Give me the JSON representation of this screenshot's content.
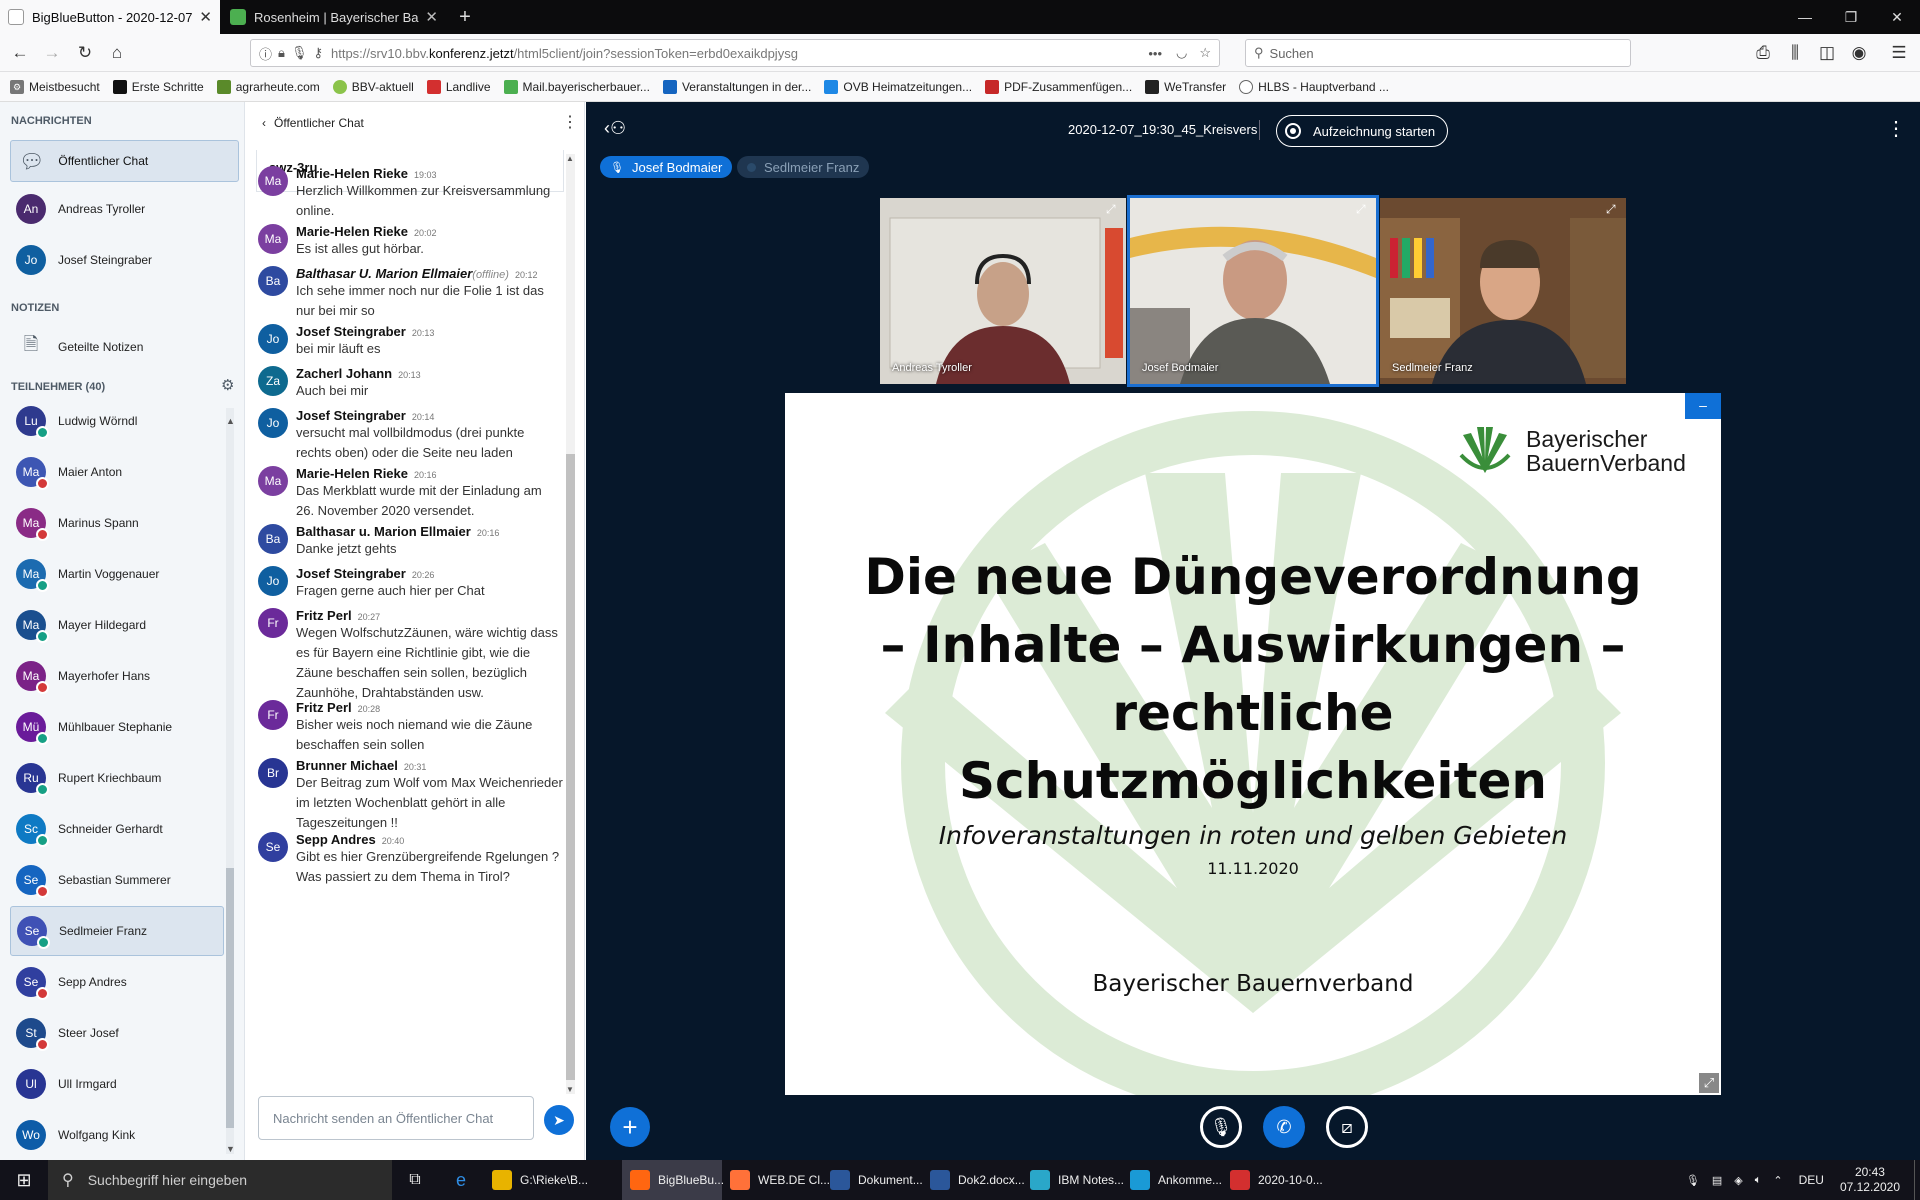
{
  "browser": {
    "tabs": [
      {
        "title": "BigBlueButton - 2020-12-07",
        "active": true
      },
      {
        "title": "Rosenheim | Bayerischer Bauern",
        "active": false
      }
    ],
    "new_tab": "+",
    "url_prefix": "https://srv10.bbv.",
    "url_domain": "konferenz.jetzt",
    "url_path": "/html5client/join?sessionToken=erbd0exaikdpjysg",
    "url_dots": "•••",
    "search_placeholder": "Suchen",
    "bookmarks": [
      "Meistbesucht",
      "Erste Schritte",
      "agrarheute.com",
      "BBV-aktuell",
      "Landlive",
      "Mail.bayerischerbauer...",
      "Veranstaltungen in der...",
      "OVB Heimatzeitungen...",
      "PDF-Zusammenfügen...",
      "WeTransfer",
      "HLBS - Hauptverband ..."
    ]
  },
  "sidebar": {
    "messages_title": "NACHRICHTEN",
    "public_chat": "Öffentlicher Chat",
    "private_chats": [
      {
        "initials": "An",
        "name": "Andreas Tyroller",
        "color": "#4a2a6e"
      },
      {
        "initials": "Jo",
        "name": "Josef Steingraber",
        "color": "#0f5fa0"
      }
    ],
    "notes_title": "NOTIZEN",
    "shared_notes": "Geteilte Notizen",
    "participants_title": "TEILNEHMER (40)",
    "participants": [
      {
        "initials": "Lu",
        "name": "Ludwig Wörndl",
        "color": "#2e3a8e",
        "status": "teal"
      },
      {
        "initials": "Ma",
        "name": "Maier Anton",
        "color": "#3d56b3",
        "status": "red"
      },
      {
        "initials": "Ma",
        "name": "Marinus Spann",
        "color": "#8a2b86",
        "status": "red"
      },
      {
        "initials": "Ma",
        "name": "Martin Voggenauer",
        "color": "#1c6bb0",
        "status": "teal"
      },
      {
        "initials": "Ma",
        "name": "Mayer Hildegard",
        "color": "#1a4f8f",
        "status": "teal"
      },
      {
        "initials": "Ma",
        "name": "Mayerhofer Hans",
        "color": "#7b2287",
        "status": "red"
      },
      {
        "initials": "Mü",
        "name": "Mühlbauer Stephanie",
        "color": "#6a1b9a",
        "status": "teal"
      },
      {
        "initials": "Ru",
        "name": "Rupert Kriechbaum",
        "color": "#283593",
        "status": "teal"
      },
      {
        "initials": "Sc",
        "name": "Schneider Gerhardt",
        "color": "#0e7ac4",
        "status": "teal"
      },
      {
        "initials": "Se",
        "name": "Sebastian Summerer",
        "color": "#1565c0",
        "status": "red"
      },
      {
        "initials": "Se",
        "name": "Sedlmeier Franz",
        "color": "#3f51b5",
        "status": "teal"
      },
      {
        "initials": "Se",
        "name": "Sepp Andres",
        "color": "#303f9f",
        "status": "red"
      },
      {
        "initials": "St",
        "name": "Steer Josef",
        "color": "#1e4a8c",
        "status": "red"
      },
      {
        "initials": "Ul",
        "name": "Ull Irmgard",
        "color": "#283593",
        "status": ""
      },
      {
        "initials": "Wo",
        "name": "Wolfgang Kink",
        "color": "#0d5ca8",
        "status": ""
      }
    ]
  },
  "chat": {
    "back_label": "Öffentlicher Chat",
    "top_snippet": "swz-3ru",
    "input_placeholder": "Nachricht senden an Öffentlicher Chat",
    "messages": [
      {
        "initials": "Ma",
        "author": "Marie-Helen Rieke",
        "offline": "",
        "time": "19:03",
        "text": "Herzlich Willkommen zur Kreisversammlung online.",
        "color": "#7b3fa0",
        "italic": false
      },
      {
        "initials": "Ma",
        "author": "Marie-Helen Rieke",
        "offline": "",
        "time": "20:02",
        "text": "Es ist alles gut hörbar.",
        "color": "#7b3fa0",
        "italic": false
      },
      {
        "initials": "Ba",
        "author": "Balthasar U. Marion Ellmaier",
        "offline": "(offline)",
        "time": "20:12",
        "text": "Ich sehe immer noch nur die Folie 1 ist das nur bei mir so",
        "color": "#2e4aa0",
        "italic": true
      },
      {
        "initials": "Jo",
        "author": "Josef Steingraber",
        "offline": "",
        "time": "20:13",
        "text": "bei mir läuft es",
        "color": "#0f5fa0",
        "italic": false
      },
      {
        "initials": "Za",
        "author": "Zacherl Johann",
        "offline": "",
        "time": "20:13",
        "text": "Auch bei mir",
        "color": "#0e6a8f",
        "italic": false
      },
      {
        "initials": "Jo",
        "author": "Josef Steingraber",
        "offline": "",
        "time": "20:14",
        "text": "versucht mal vollbildmodus (drei punkte rechts oben) oder die Seite neu laden",
        "color": "#0f5fa0",
        "italic": false
      },
      {
        "initials": "Ma",
        "author": "Marie-Helen Rieke",
        "offline": "",
        "time": "20:16",
        "text": "Das Merkblatt wurde mit der Einladung am 26. November 2020 versendet.",
        "color": "#7b3fa0",
        "italic": false
      },
      {
        "initials": "Ba",
        "author": "Balthasar u. Marion Ellmaier",
        "offline": "",
        "time": "20:16",
        "text": "Danke jetzt gehts",
        "color": "#2e4aa0",
        "italic": false
      },
      {
        "initials": "Jo",
        "author": "Josef Steingraber",
        "offline": "",
        "time": "20:26",
        "text": "Fragen gerne auch hier per Chat",
        "color": "#0f5fa0",
        "italic": false
      },
      {
        "initials": "Fr",
        "author": "Fritz Perl",
        "offline": "",
        "time": "20:27",
        "text": "Wegen WolfschutzZäunen, wäre wichtig dass es für Bayern eine Richtlinie gibt, wie die Zäune beschaffen sein sollen, bezüglich Zaunhöhe, Drahtabständen usw.",
        "color": "#6b2a9a",
        "italic": false
      },
      {
        "initials": "Fr",
        "author": "Fritz Perl",
        "offline": "",
        "time": "20:28",
        "text": "Bisher weis noch niemand wie die Zäune beschaffen sein sollen",
        "color": "#6b2a9a",
        "italic": false
      },
      {
        "initials": "Br",
        "author": "Brunner Michael",
        "offline": "",
        "time": "20:31",
        "text": "Der Beitrag zum Wolf vom Max Weichenrieder im letzten Wochenblatt gehört in alle Tageszeitungen !!",
        "color": "#283593",
        "italic": false
      },
      {
        "initials": "Se",
        "author": "Sepp Andres",
        "offline": "",
        "time": "20:40",
        "text": "Gibt es hier Grenzübergreifende Rgelungen ? Was passiert zu dem Thema in Tirol?",
        "color": "#303f9f",
        "italic": false
      }
    ]
  },
  "meeting": {
    "title": "2020-12-07_19:30_45_Kreisvers",
    "record_label": "Aufzeichnung starten",
    "talkers": [
      {
        "name": "Josef Bodmaier",
        "active": true
      },
      {
        "name": "Sedlmeier Franz",
        "active": false
      }
    ],
    "videos": [
      {
        "name": "Andreas Tyroller",
        "highlight": false
      },
      {
        "name": "Josef Bodmaier",
        "highlight": true
      },
      {
        "name": "Sedlmeier Franz",
        "highlight": false
      }
    ],
    "slide": {
      "logo_line1": "Bayerischer",
      "logo_line2": "BauernVerband",
      "title_lines": [
        "Die neue Düngeverordnung",
        "– Inhalte – Auswirkungen –",
        "rechtliche",
        "Schutzmöglichkeiten"
      ],
      "subtitle": "Infoveranstaltungen in roten und gelben Gebieten",
      "date": "11.11.2020",
      "footer": "Bayerischer Bauernverband"
    },
    "accent": "#0f70d7"
  },
  "taskbar": {
    "search_placeholder": "Suchbegriff hier eingeben",
    "apps": [
      {
        "label": "G:\\Rieke\\B...",
        "color": "#e8b300",
        "active": false
      },
      {
        "label": "BigBlueBu...",
        "color": "#ff6611",
        "active": true
      },
      {
        "label": "WEB.DE Cl...",
        "color": "#ff7139",
        "active": false
      },
      {
        "label": "Dokument...",
        "color": "#2b579a",
        "active": false
      },
      {
        "label": "Dok2.docx...",
        "color": "#2b579a",
        "active": false
      },
      {
        "label": "IBM Notes...",
        "color": "#2aa7c9",
        "active": false
      },
      {
        "label": "Ankomme...",
        "color": "#1a9ad6",
        "active": false
      },
      {
        "label": "2020-10-0...",
        "color": "#d32f2f",
        "active": false
      }
    ],
    "lang": "DEU",
    "time": "20:43",
    "date": "07.12.2020"
  }
}
